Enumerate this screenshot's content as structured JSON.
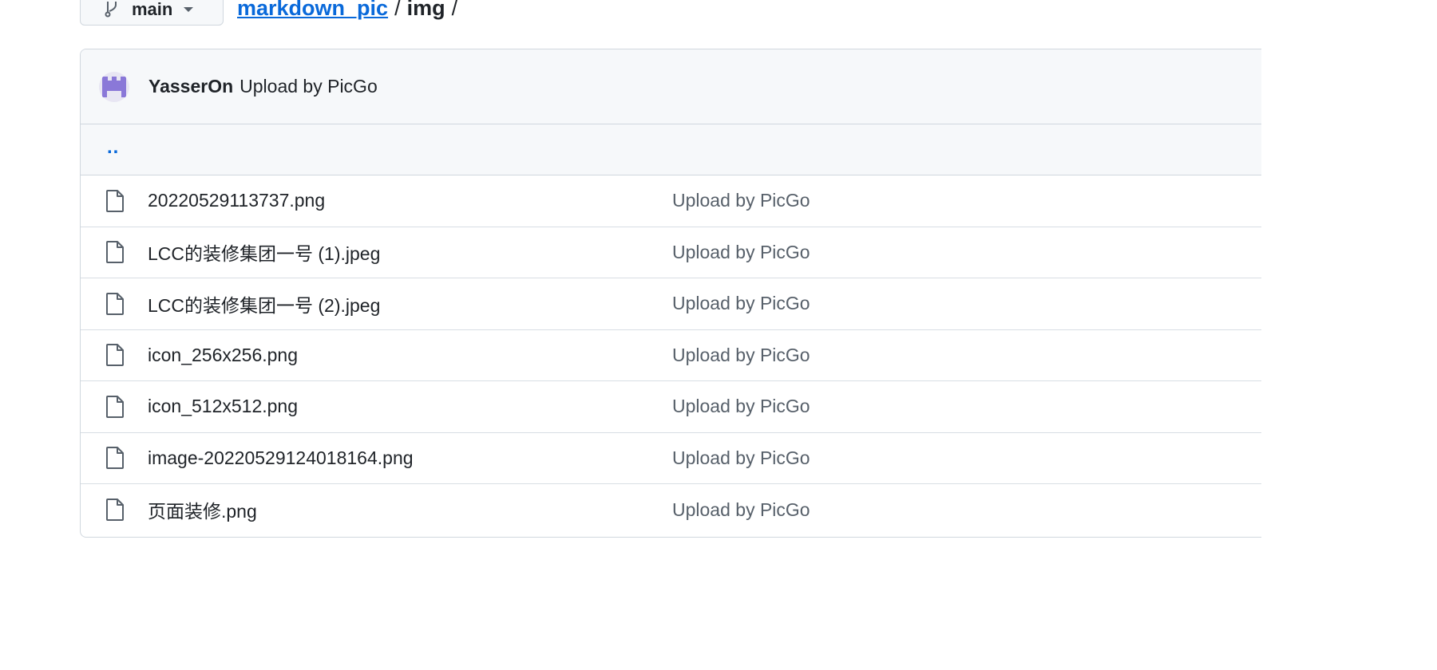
{
  "branch": {
    "label": "main",
    "icon": "git-branch-icon"
  },
  "breadcrumb": {
    "repo": "markdown_pic",
    "sep1": "/",
    "folder": "img",
    "sep2": "/"
  },
  "commit": {
    "author": "YasserOn",
    "message": "Upload by PicGo"
  },
  "parent": {
    "label": ".."
  },
  "files": [
    {
      "name": "20220529113737.png",
      "commit": "Upload by PicGo",
      "icon": "file-icon"
    },
    {
      "name": "LCC的装修集团一号 (1).jpeg",
      "commit": "Upload by PicGo",
      "icon": "file-icon"
    },
    {
      "name": "LCC的装修集团一号 (2).jpeg",
      "commit": "Upload by PicGo",
      "icon": "file-icon"
    },
    {
      "name": "icon_256x256.png",
      "commit": "Upload by PicGo",
      "icon": "file-icon"
    },
    {
      "name": "icon_512x512.png",
      "commit": "Upload by PicGo",
      "icon": "file-icon"
    },
    {
      "name": "image-20220529124018164.png",
      "commit": "Upload by PicGo",
      "icon": "file-icon"
    },
    {
      "name": "页面装修.png",
      "commit": "Upload by PicGo",
      "icon": "file-icon"
    }
  ],
  "colors": {
    "link": "#0969da",
    "text": "#1f2328",
    "muted": "#57606a",
    "border": "#d0d7de",
    "header_bg": "#f6f8fa",
    "avatar": "#8a78d8"
  }
}
